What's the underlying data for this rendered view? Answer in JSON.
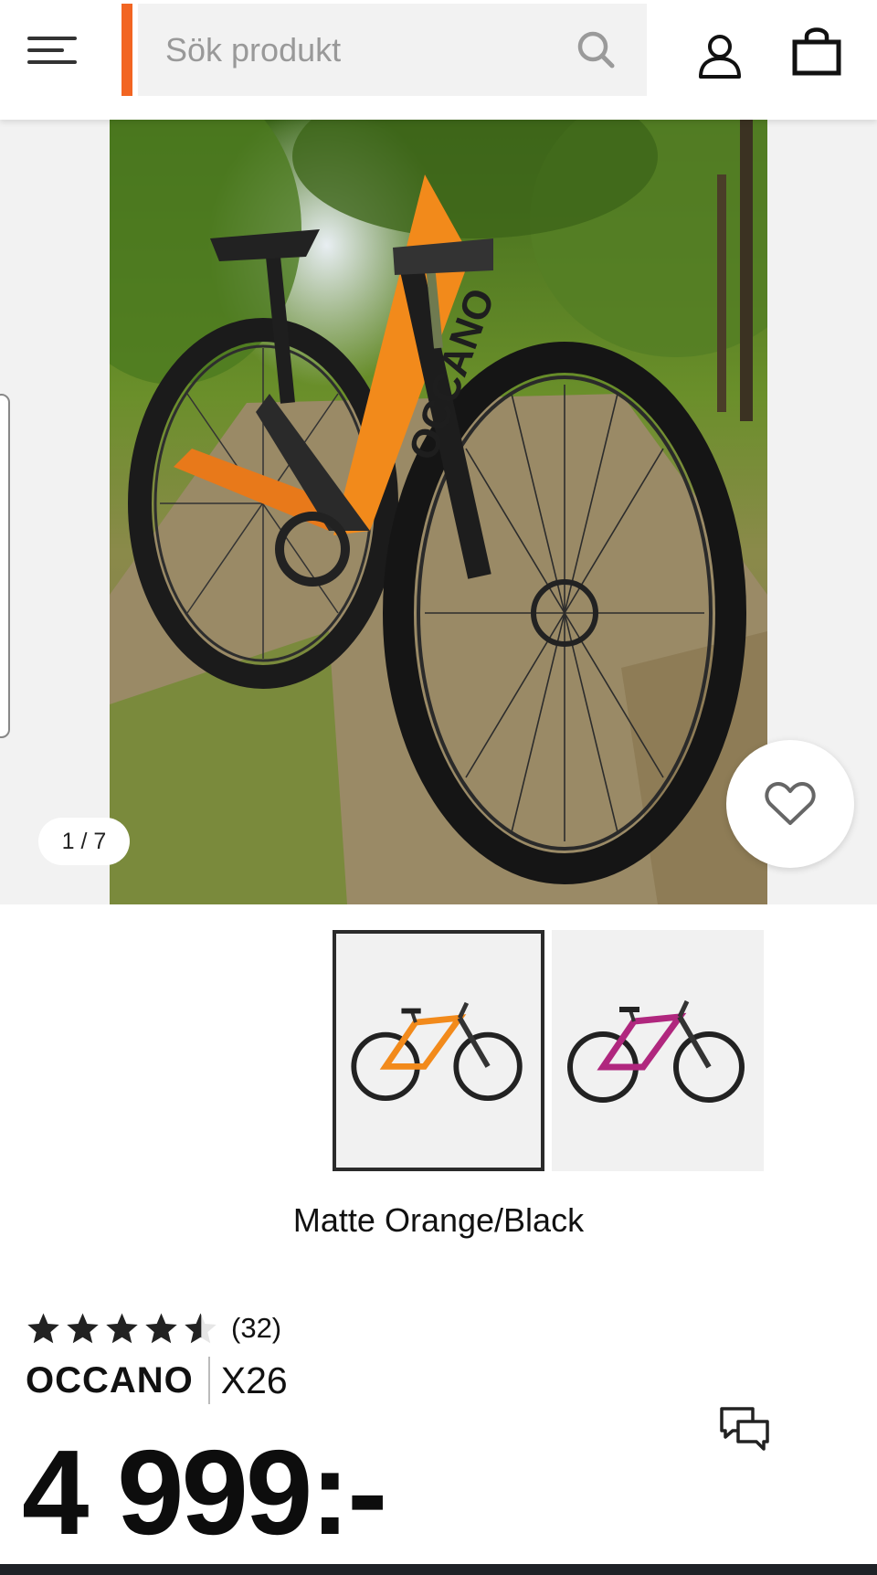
{
  "search": {
    "placeholder": "Sök produkt"
  },
  "gallery": {
    "counter": "1 / 7",
    "thumbnails": [
      {
        "color": "#f28a1b",
        "selected": true
      },
      {
        "color": "#b0277e",
        "selected": false
      }
    ]
  },
  "product": {
    "color_name": "Matte Orange/Black",
    "rating": 4.5,
    "review_count": "(32)",
    "brand": "OCCANO",
    "model": "X26",
    "price": "4 999:-"
  },
  "colors": {
    "accent": "#f26522",
    "frame_orange": "#f28a1b",
    "frame_magenta": "#b0277e",
    "text": "#111111"
  },
  "icons": [
    "menu-icon",
    "search-icon",
    "account-icon",
    "cart-icon",
    "heart-icon",
    "chat-icon",
    "star-icon"
  ]
}
